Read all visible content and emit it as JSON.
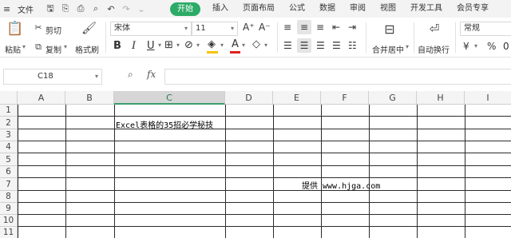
{
  "menubar": {
    "file_label": "文件",
    "tabs": [
      {
        "label": "开始",
        "active": true
      },
      {
        "label": "插入"
      },
      {
        "label": "页面布局"
      },
      {
        "label": "公式"
      },
      {
        "label": "数据"
      },
      {
        "label": "审阅"
      },
      {
        "label": "视图"
      },
      {
        "label": "开发工具"
      },
      {
        "label": "会员专享"
      }
    ],
    "active_color": "#2cab67"
  },
  "ribbon": {
    "paste_label": "粘贴",
    "cut_label": "剪切",
    "copy_label": "复制",
    "format_painter_label": "格式刷",
    "font_name": "宋体",
    "font_size": "11",
    "merge_label": "合并居中",
    "wrap_label": "自动换行",
    "number_format": "常规",
    "currency_symbol": "¥",
    "percent_symbol": "%",
    "thousands_symbol": "0"
  },
  "formula_bar": {
    "cell_ref": "C18",
    "fx_label": "fx",
    "formula": ""
  },
  "sheet": {
    "columns": [
      "A",
      "B",
      "C",
      "D",
      "E",
      "F",
      "G",
      "H",
      "I"
    ],
    "selected_column": "C",
    "rows": [
      "1",
      "2",
      "3",
      "4",
      "5",
      "6",
      "7",
      "8",
      "9",
      "10",
      "11"
    ],
    "cells": {
      "C2": "Excel表格的35招必学秘技",
      "E7": "提供 www.hjga.com"
    }
  }
}
